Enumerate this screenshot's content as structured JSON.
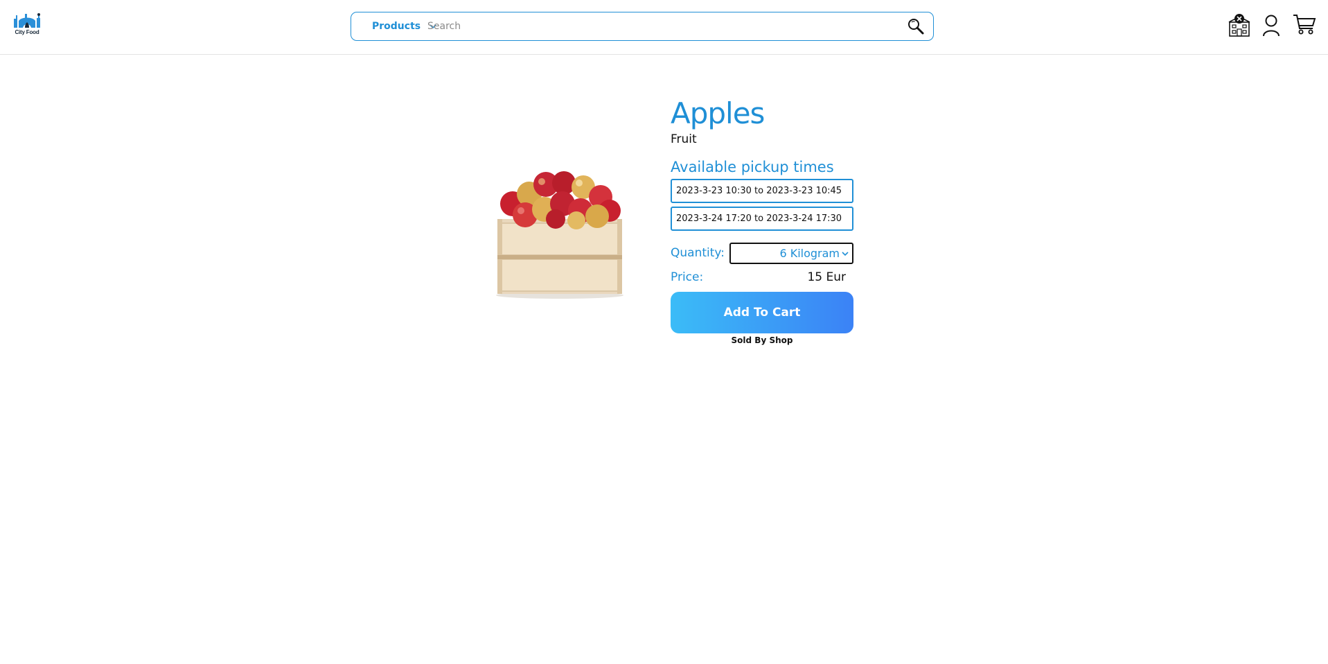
{
  "header": {
    "logo_text": "City Food",
    "logo_icon": "city-food-logo",
    "search": {
      "category_label": "Products",
      "placeholder": "Search",
      "value": "",
      "search_icon": "search-icon"
    },
    "icons": [
      "shop-icon",
      "user-icon",
      "cart-icon"
    ]
  },
  "product": {
    "image": "apples-in-crate",
    "title": "Apples",
    "category": "Fruit",
    "pickup_heading": "Available pickup times",
    "pickup_times": [
      "2023-3-23 10:30 to 2023-3-23 10:45",
      "2023-3-24 17:20 to 2023-3-24 17:30"
    ],
    "quantity_label": "Quantity:",
    "quantity_value": "6 Kilogram",
    "price_label": "Price:",
    "price_value": "15 Eur",
    "add_to_cart_label": "Add To Cart",
    "sold_by": "Sold By Shop"
  },
  "colors": {
    "accent": "#1f8fd6",
    "button_gradient_start": "#3bbcf7",
    "button_gradient_end": "#3b82f6"
  }
}
